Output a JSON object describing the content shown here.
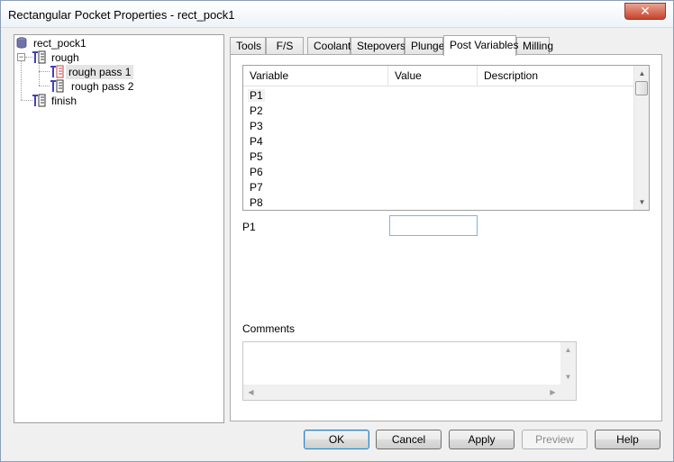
{
  "window": {
    "title": "Rectangular Pocket Properties - rect_pock1",
    "close_glyph": "✕"
  },
  "tree": {
    "root": "rect_pock1",
    "group_rough": "rough",
    "rough_pass_1": "rough pass 1",
    "rough_pass_2": "rough pass 2",
    "finish": "finish",
    "expander_glyph": "−"
  },
  "tabs": [
    {
      "label": "Tools"
    },
    {
      "label": "F/S"
    },
    {
      "label": "Coolant"
    },
    {
      "label": "Stepovers"
    },
    {
      "label": "Plunge"
    },
    {
      "label": "Post Variables",
      "active": true
    },
    {
      "label": "Milling"
    }
  ],
  "variables_table": {
    "columns": [
      "Variable",
      "Value",
      "Description"
    ],
    "rows": [
      "P1",
      "P2",
      "P3",
      "P4",
      "P5",
      "P6",
      "P7",
      "P8"
    ]
  },
  "selected_variable": {
    "label": "P1",
    "value": ""
  },
  "comments": {
    "label": "Comments",
    "value": ""
  },
  "buttons": {
    "ok": "OK",
    "cancel": "Cancel",
    "apply": "Apply",
    "preview": "Preview",
    "help": "Help"
  },
  "colors": {
    "op_icon": "#4040c8",
    "close_button": "#c7432b",
    "focus_border": "#7eb4ea"
  }
}
